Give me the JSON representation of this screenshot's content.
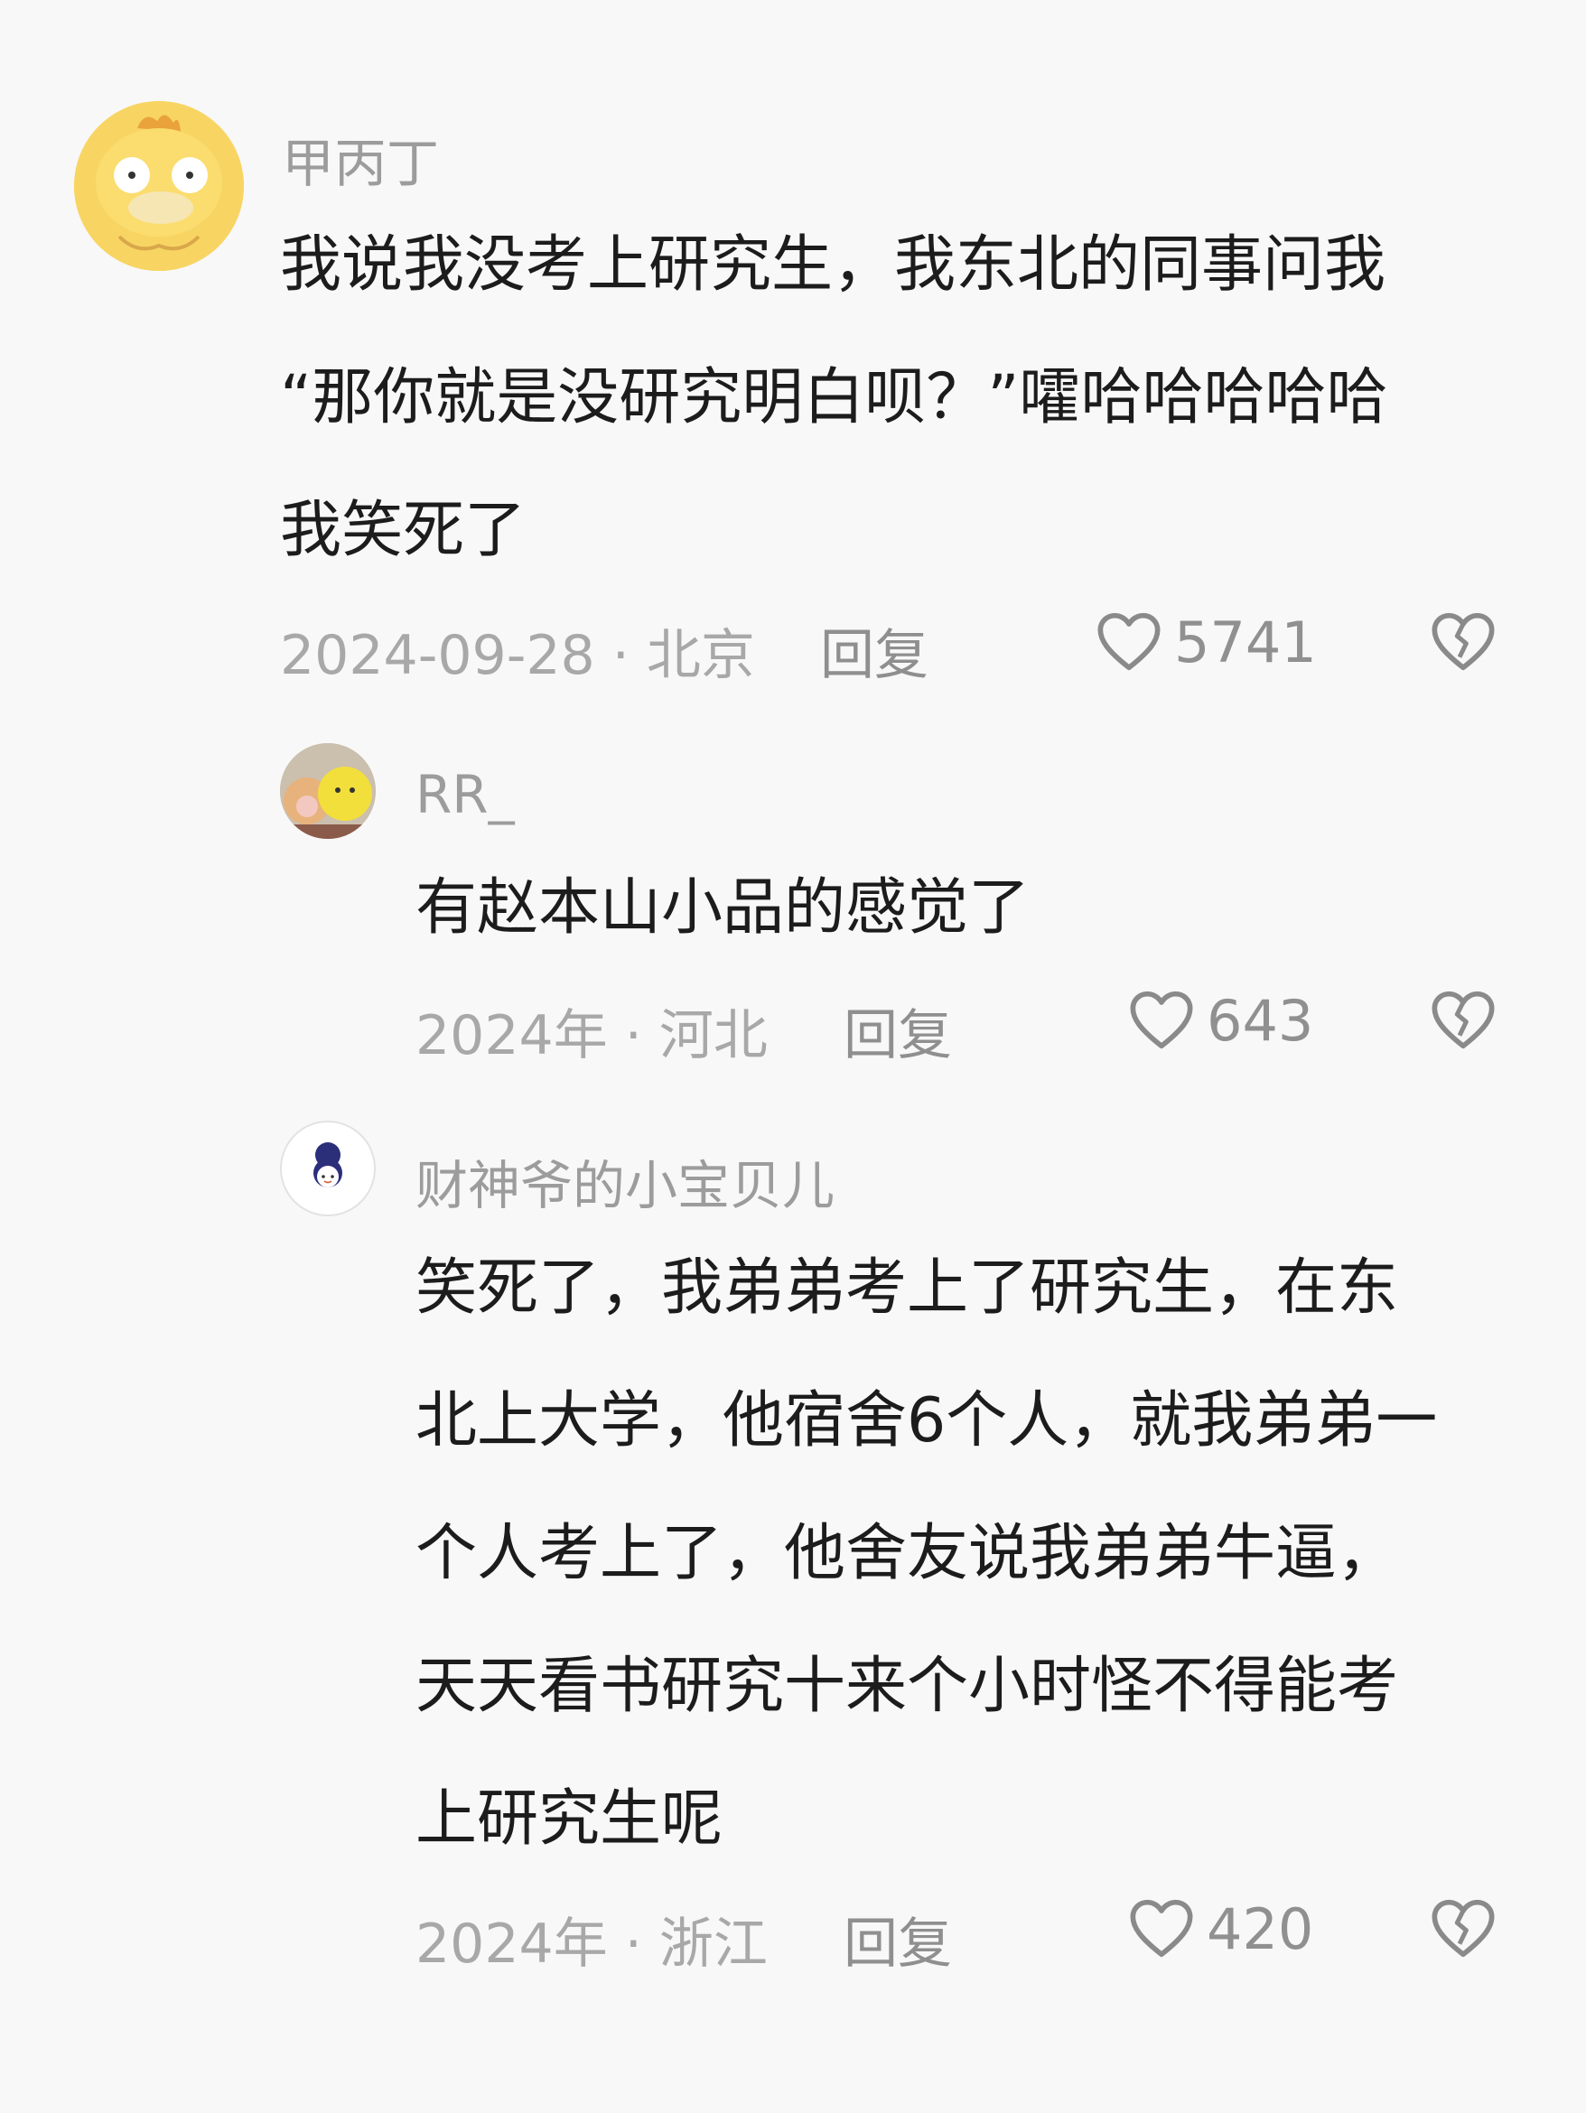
{
  "comments": [
    {
      "username": "甲丙丁",
      "avatar_icon": "psyduck-avatar-icon",
      "lines": [
        "我说我没考上研究生，我东北的同事问我",
        "“那你就是没研究明白呗？”嚯哈哈哈哈哈",
        "我笑死了"
      ],
      "meta": "2024-09-28 · 北京",
      "reply_label": "回复",
      "likes": "5741"
    }
  ],
  "replies": [
    {
      "username": "RR_",
      "avatar_icon": "plush-toys-avatar-icon",
      "lines": [
        "有赵本山小品的感觉了"
      ],
      "meta": "2024年 · 河北",
      "reply_label": "回复",
      "likes": "643"
    },
    {
      "username": "财神爷的小宝贝儿",
      "avatar_icon": "cartoon-girl-avatar-icon",
      "lines": [
        "笑死了，我弟弟考上了研究生，在东",
        "北上大学，他宿舍6个人，就我弟弟一",
        "个人考上了，他舍友说我弟弟牛逼，",
        "天天看书研究十来个小时怪不得能考",
        "上研究生呢"
      ],
      "meta": "2024年 · 浙江",
      "reply_label": "回复",
      "likes": "420"
    }
  ],
  "icons": {
    "like": "heart-outline-icon",
    "dislike": "broken-heart-icon"
  },
  "colors": {
    "background": "#f8f8f8",
    "text": "#1c1c1c",
    "muted": "#a0a0a0"
  }
}
